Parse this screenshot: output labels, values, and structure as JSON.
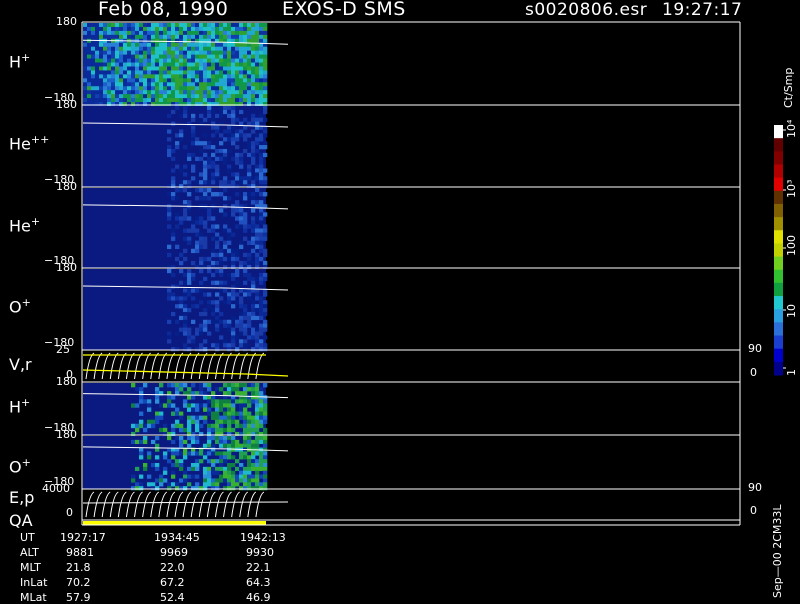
{
  "header": {
    "date": "Feb 08, 1990",
    "instrument": "EXOS-D SMS",
    "file": "s0020806.esr",
    "time": "19:27:17"
  },
  "panels": [
    {
      "label": "H",
      "sup": "+",
      "ytop": "180",
      "ybot": "−180"
    },
    {
      "label": "He",
      "sup": "++",
      "ytop": "180",
      "ybot": "−180"
    },
    {
      "label": "He",
      "sup": "+",
      "ytop": "180",
      "ybot": "−180"
    },
    {
      "label": "O",
      "sup": "+",
      "ytop": "180",
      "ybot": "−180"
    },
    {
      "label": "V,r",
      "sup": "",
      "ytop": "25",
      "ybot": "0",
      "rtop": "90",
      "rbot": "0"
    },
    {
      "label": "H",
      "sup": "+",
      "ytop": "180",
      "ybot": "−180"
    },
    {
      "label": "O",
      "sup": "+",
      "ytop": "180",
      "ybot": "−180"
    },
    {
      "label": "E,p",
      "sup": "",
      "ytop": "4000",
      "ybot": "0",
      "rtop": "90",
      "rbot": "0"
    },
    {
      "label": "QA",
      "sup": "",
      "ytop": "",
      "ybot": ""
    }
  ],
  "colorbar": {
    "unit": "Ct/Smp",
    "ticks": [
      "1",
      "10",
      "100",
      "10³",
      "10⁴"
    ],
    "colors": [
      "#00008b",
      "#0000cd",
      "#1a3fd0",
      "#2a70d8",
      "#2aa0e0",
      "#20c8d0",
      "#10a040",
      "#30c030",
      "#70d020",
      "#c0d000",
      "#e0e000",
      "#a09000",
      "#806000",
      "#603000",
      "#e00000",
      "#b00000",
      "#800000",
      "#600000",
      "#ffffff"
    ]
  },
  "footer": {
    "rows": [
      {
        "name": "UT",
        "values": [
          "1927:17",
          "1934:45",
          "1942:13"
        ]
      },
      {
        "name": "ALT",
        "values": [
          "9881",
          "9969",
          "9930"
        ]
      },
      {
        "name": "MLT",
        "values": [
          "21.8",
          "22.0",
          "22.1"
        ]
      },
      {
        "name": "InLat",
        "values": [
          "70.2",
          "67.2",
          "64.3"
        ]
      },
      {
        "name": "MLat",
        "values": [
          "57.9",
          "52.4",
          "46.9"
        ]
      }
    ],
    "credit": "Sep—00 2CM33L"
  },
  "chart_data": {
    "type": "heatmap",
    "x_ticks_ut": [
      "1927:17",
      "1934:45",
      "1942:13"
    ],
    "panels": [
      "H+",
      "He++",
      "He+",
      "O+",
      "V,r",
      "H+",
      "O+",
      "E,p",
      "QA"
    ],
    "y_ranges": {
      "H+": [
        -180,
        180
      ],
      "He++": [
        -180,
        180
      ],
      "He+": [
        -180,
        180
      ],
      "O+": [
        -180,
        180
      ],
      "V,r": [
        0,
        25
      ],
      "E,p": [
        0,
        4000
      ]
    },
    "color_scale": "log",
    "color_range": [
      1,
      10000
    ],
    "color_unit": "Ct/Smp"
  }
}
